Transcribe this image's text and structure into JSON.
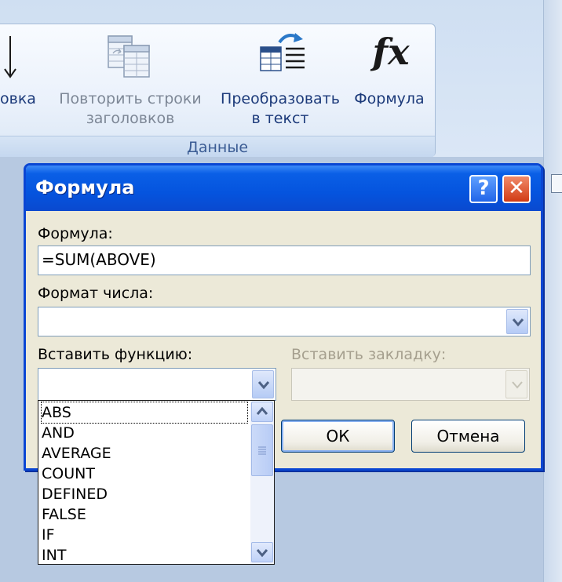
{
  "ribbon": {
    "partial_label": "овка",
    "repeat_header_label_line1": "Повторить строки",
    "repeat_header_label_line2": "заголовков",
    "convert_label_line1": "Преобразовать",
    "convert_label_line2": "в текст",
    "formula_label": "Формула",
    "formula_icon_text": "fx",
    "group_label": "Данные"
  },
  "dialog": {
    "title": "Формула",
    "help_button": "?",
    "close_button": "✕",
    "formula_label": "Формула:",
    "formula_value": "=SUM(ABOVE)",
    "number_format_label": "Формат числа:",
    "number_format_value": "",
    "insert_function_label": "Вставить функцию:",
    "insert_bookmark_label": "Вставить закладку:",
    "ok_label": "ОК",
    "cancel_label": "Отмена"
  },
  "function_list": {
    "items": [
      "ABS",
      "AND",
      "AVERAGE",
      "COUNT",
      "DEFINED",
      "FALSE",
      "IF",
      "INT"
    ]
  },
  "colors": {
    "titlebar": "#0554de",
    "dialog_bg": "#ece9d8",
    "ribbon_text": "#1c3a7a",
    "group_label": "#3b5c94"
  }
}
